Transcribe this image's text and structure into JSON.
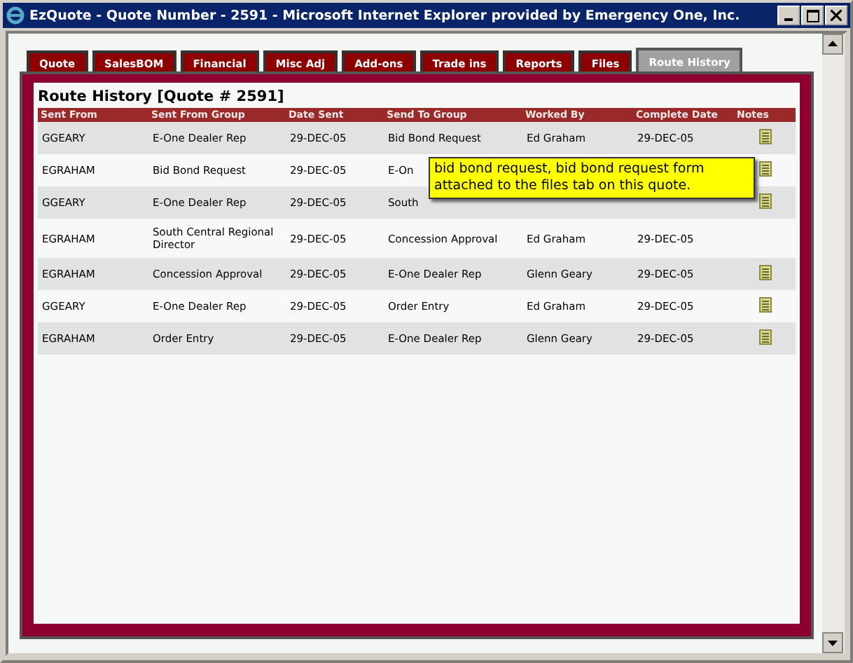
{
  "window": {
    "title": "EzQuote - Quote Number - 2591 - Microsoft Internet Explorer provided by Emergency One, Inc."
  },
  "tabs": [
    {
      "label": "Quote",
      "selected": false
    },
    {
      "label": "SalesBOM",
      "selected": false
    },
    {
      "label": "Financial",
      "selected": false
    },
    {
      "label": "Misc Adj",
      "selected": false
    },
    {
      "label": "Add-ons",
      "selected": false
    },
    {
      "label": "Trade ins",
      "selected": false
    },
    {
      "label": "Reports",
      "selected": false
    },
    {
      "label": "Files",
      "selected": false
    },
    {
      "label": "Route History",
      "selected": true
    }
  ],
  "heading": "Route History [Quote # 2591]",
  "table": {
    "columns": [
      "Sent From",
      "Sent From Group",
      "Date Sent",
      "Send To Group",
      "Worked By",
      "Complete Date",
      "Notes"
    ],
    "rows": [
      {
        "sent_from": "GGEARY",
        "sent_from_group": "E-One Dealer Rep",
        "date_sent": "29-DEC-05",
        "send_to_group": "Bid Bond Request",
        "worked_by": "Ed Graham",
        "complete_date": "29-DEC-05",
        "has_note": true
      },
      {
        "sent_from": "EGRAHAM",
        "sent_from_group": "Bid Bond Request",
        "date_sent": "29-DEC-05",
        "send_to_group": "E-On",
        "worked_by": "",
        "complete_date": "",
        "has_note": true
      },
      {
        "sent_from": "GGEARY",
        "sent_from_group": "E-One Dealer Rep",
        "date_sent": "29-DEC-05",
        "send_to_group": "South",
        "worked_by": "",
        "complete_date": "",
        "has_note": true
      },
      {
        "sent_from": "EGRAHAM",
        "sent_from_group": "South Central Regional Director",
        "date_sent": "29-DEC-05",
        "send_to_group": "Concession Approval",
        "worked_by": "Ed Graham",
        "complete_date": "29-DEC-05",
        "has_note": false
      },
      {
        "sent_from": "EGRAHAM",
        "sent_from_group": "Concession Approval",
        "date_sent": "29-DEC-05",
        "send_to_group": "E-One Dealer Rep",
        "worked_by": "Glenn Geary",
        "complete_date": "29-DEC-05",
        "has_note": true
      },
      {
        "sent_from": "GGEARY",
        "sent_from_group": "E-One Dealer Rep",
        "date_sent": "29-DEC-05",
        "send_to_group": "Order Entry",
        "worked_by": "Ed Graham",
        "complete_date": "29-DEC-05",
        "has_note": true
      },
      {
        "sent_from": "EGRAHAM",
        "sent_from_group": "Order Entry",
        "date_sent": "29-DEC-05",
        "send_to_group": "E-One Dealer Rep",
        "worked_by": "Glenn Geary",
        "complete_date": "29-DEC-05",
        "has_note": true
      }
    ]
  },
  "tooltip": "bid bond request, bid bond request form attached to the files tab on this quote."
}
